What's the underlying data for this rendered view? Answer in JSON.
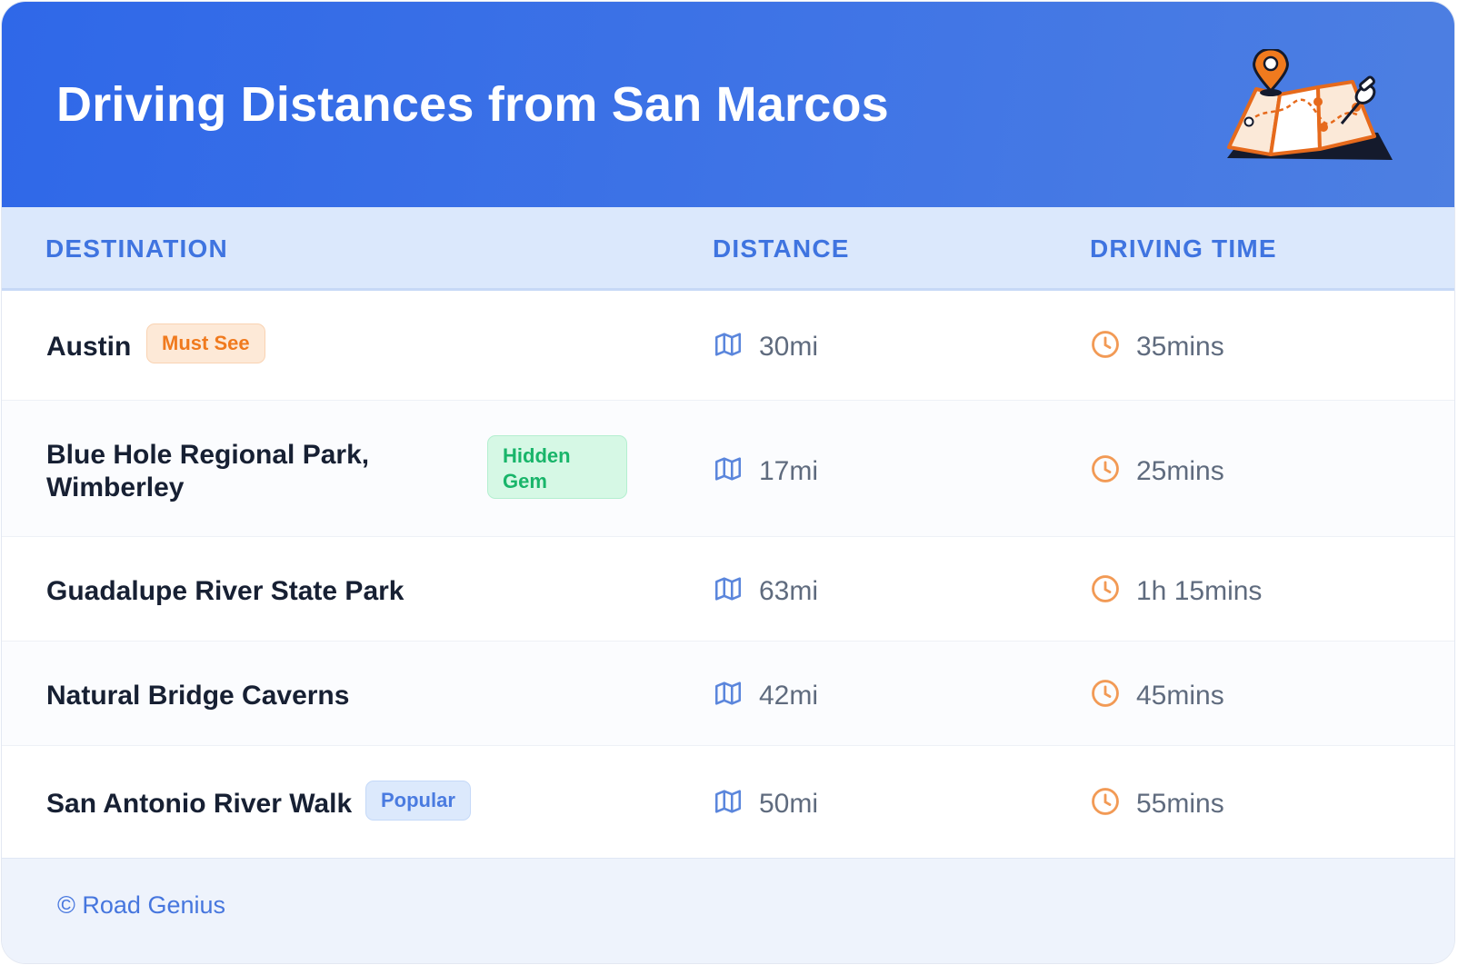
{
  "header": {
    "title": "Driving Distances from San Marcos",
    "illustration_icon": "map-with-pin-icon",
    "gradient_colors": [
      "#2f68e8",
      "#4d7fe2"
    ]
  },
  "table": {
    "columns": [
      "DESTINATION",
      "DISTANCE",
      "DRIVING TIME"
    ],
    "distance_icon": "map-icon",
    "time_icon": "clock-icon",
    "rows": [
      {
        "destination": "Austin",
        "badge": "Must See",
        "badge_color": "#f07a1e",
        "distance": "30mi",
        "time": "35mins"
      },
      {
        "destination": "Blue Hole Regional Park, Wimberley",
        "badge": "Hidden Gem",
        "badge_color": "#19b56a",
        "distance": "17mi",
        "time": "25mins"
      },
      {
        "destination": "Guadalupe River State Park",
        "badge": "",
        "distance": "63mi",
        "time": "1h 15mins"
      },
      {
        "destination": "Natural Bridge Caverns",
        "badge": "",
        "distance": "42mi",
        "time": "45mins"
      },
      {
        "destination": "San Antonio River Walk",
        "badge": "Popular",
        "badge_color": "#4a7be0",
        "distance": "50mi",
        "time": "55mins"
      }
    ]
  },
  "footer": {
    "credit": "© Road Genius"
  }
}
